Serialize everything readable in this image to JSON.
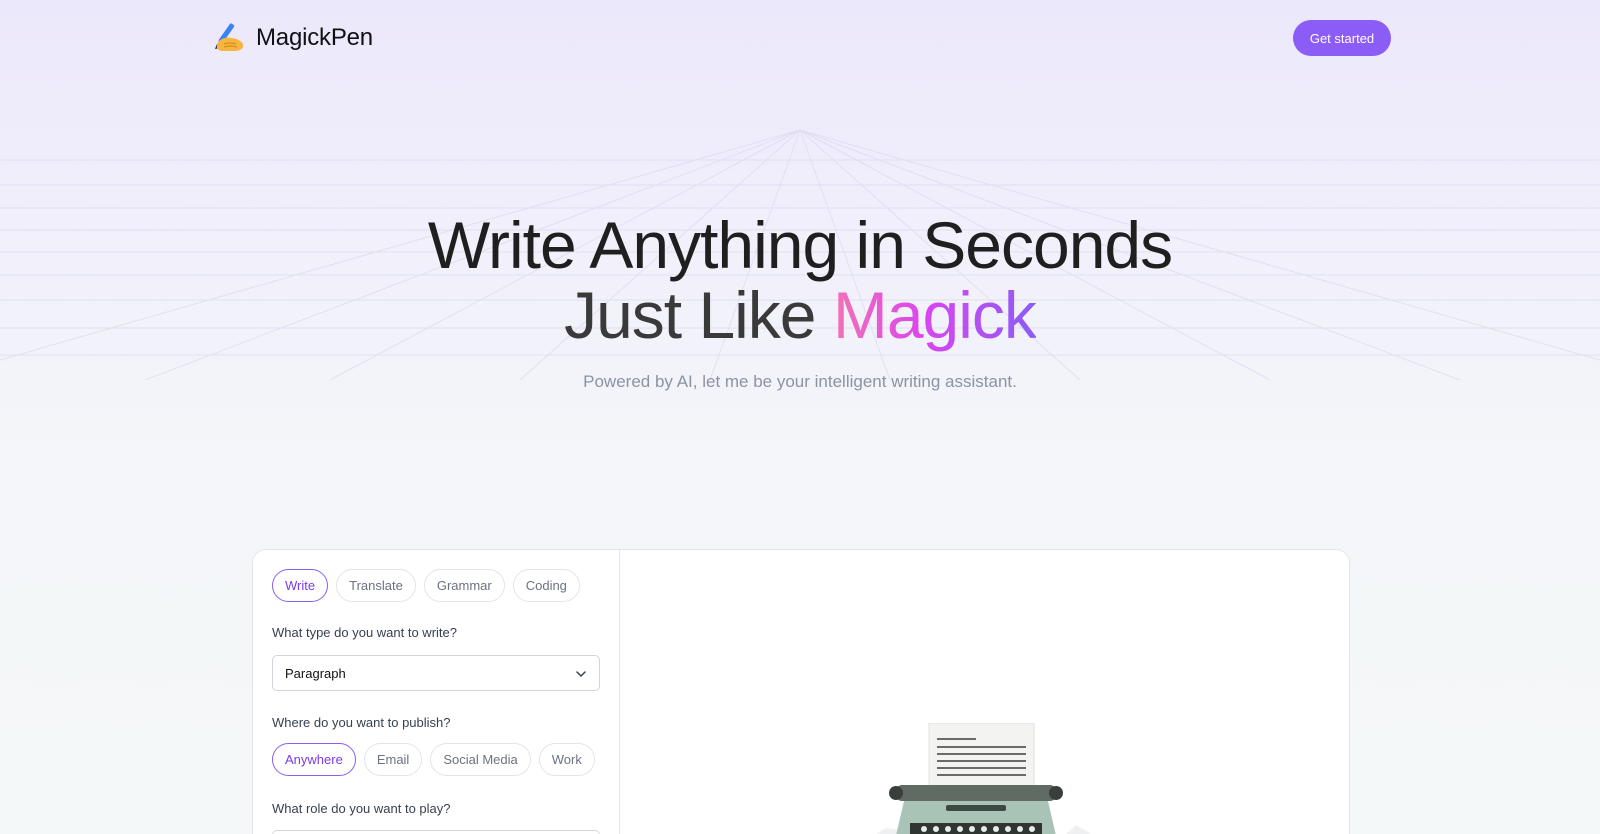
{
  "brand": {
    "name": "MagickPen",
    "logo_icon": "writing-hand-icon"
  },
  "nav": {
    "cta_label": "Get started"
  },
  "hero": {
    "line1": "Write Anything  in Seconds",
    "line2_prefix": "Just Like ",
    "line2_highlight": "Magick",
    "subtitle": "Powered by AI, let me be your intelligent writing assistant."
  },
  "tool": {
    "tabs": [
      {
        "label": "Write",
        "active": true
      },
      {
        "label": "Translate",
        "active": false
      },
      {
        "label": "Grammar",
        "active": false
      },
      {
        "label": "Coding",
        "active": false
      }
    ],
    "type_question": "What type do you want to write?",
    "type_value": "Paragraph",
    "publish_question": "Where do you want to publish?",
    "publish_options": [
      {
        "label": "Anywhere",
        "active": true
      },
      {
        "label": "Email",
        "active": false
      },
      {
        "label": "Social Media",
        "active": false
      },
      {
        "label": "Work",
        "active": false
      }
    ],
    "role_question": "What role do you want to play?",
    "illustration": "typewriter-illustration"
  },
  "colors": {
    "accent": "#8b5cf6",
    "magic_gradient": [
      "#f472b6",
      "#d946ef",
      "#8b5cf6"
    ]
  }
}
